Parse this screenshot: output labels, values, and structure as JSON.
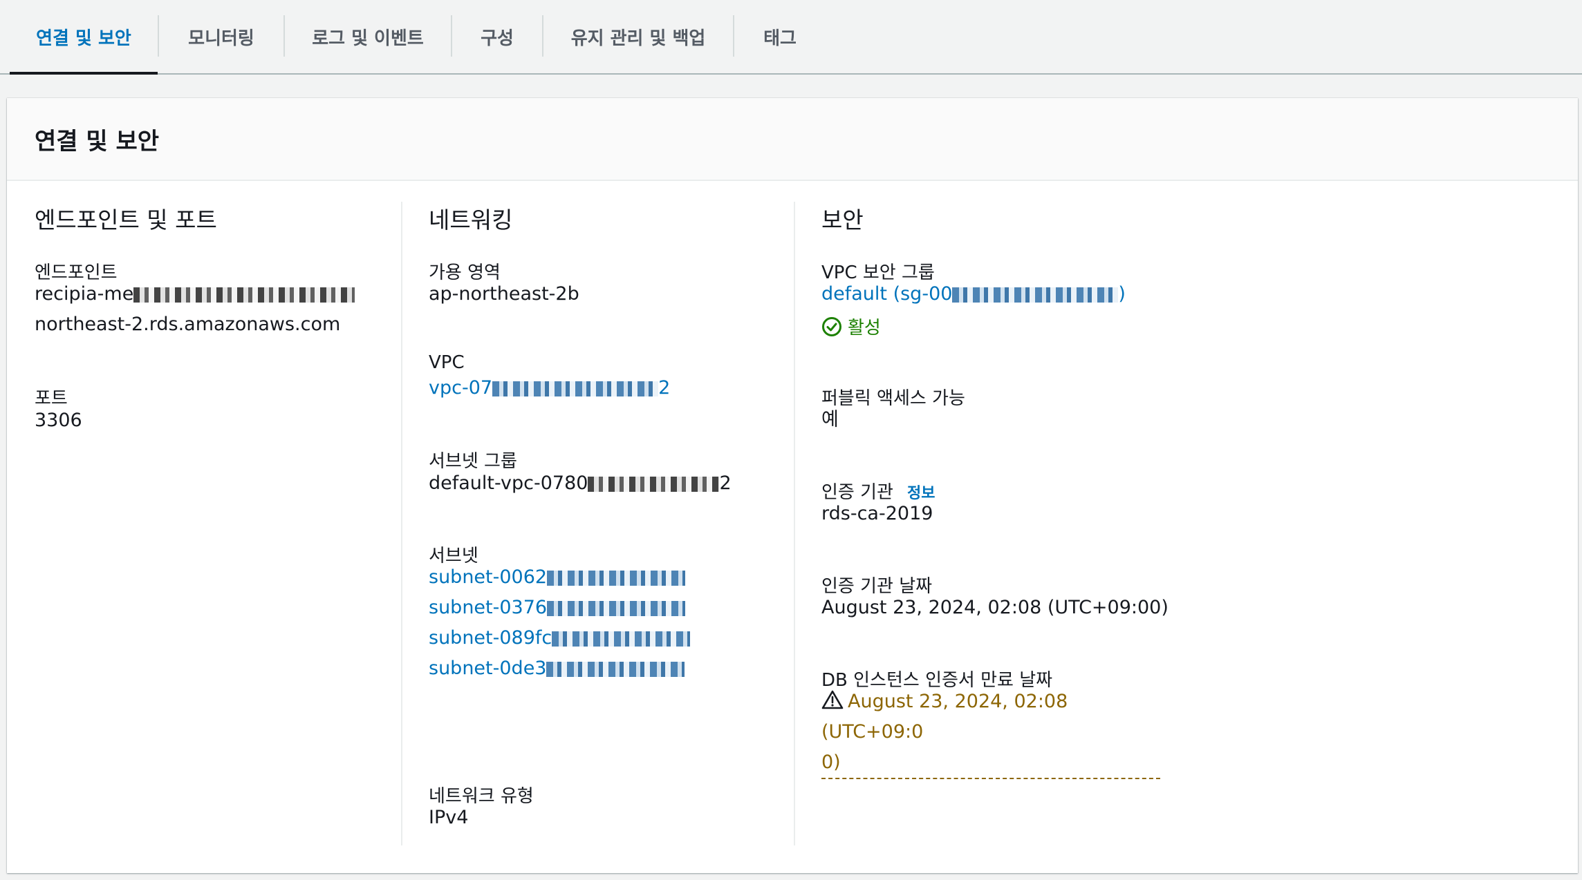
{
  "tabs": [
    {
      "label": "연결 및 보안",
      "active": true
    },
    {
      "label": "모니터링"
    },
    {
      "label": "로그 및 이벤트"
    },
    {
      "label": "구성"
    },
    {
      "label": "유지 관리 및 백업"
    },
    {
      "label": "태그"
    }
  ],
  "panel": {
    "title": "연결 및 보안"
  },
  "endpoint_section": {
    "heading": "엔드포인트 및 포트",
    "endpoint_label": "엔드포인트",
    "endpoint_line1": "recipia-me",
    "endpoint_line2": "northeast-2.rds.amazonaws.com",
    "port_label": "포트",
    "port_value": "3306"
  },
  "networking": {
    "heading": "네트워킹",
    "az_label": "가용 영역",
    "az_value": "ap-northeast-2b",
    "vpc_label": "VPC",
    "vpc_prefix": "vpc-07",
    "vpc_suffix": "2",
    "subnet_group_label": "서브넷 그룹",
    "subnet_group_prefix": "default-vpc-0780",
    "subnet_group_suffix": "2",
    "subnets_label": "서브넷",
    "subnets": [
      "subnet-0062",
      "subnet-0376",
      "subnet-089fc",
      "subnet-0de3"
    ],
    "network_type_label": "네트워크 유형",
    "network_type_value": "IPv4"
  },
  "security": {
    "heading": "보안",
    "vpc_sg_label": "VPC 보안 그룹",
    "vpc_sg_prefix": "default (sg-00",
    "vpc_sg_suffix": ")",
    "sg_status": "활성",
    "public_access_label": "퍼블릭 액세스 가능",
    "public_access_value": "예",
    "ca_label": "인증 기관",
    "ca_info": "정보",
    "ca_value": "rds-ca-2019",
    "ca_date_label": "인증 기관 날짜",
    "ca_date_value": "August 23, 2024, 02:08 (UTC+09:00)",
    "cert_expiry_label": "DB 인스턴스 인증서 만료 날짜",
    "cert_expiry_line1": "August 23, 2024, 02:08 (UTC+09:0",
    "cert_expiry_line2": "0)"
  },
  "colors": {
    "link": "#0073bb",
    "success": "#1d8102",
    "warning": "#8d6605"
  }
}
